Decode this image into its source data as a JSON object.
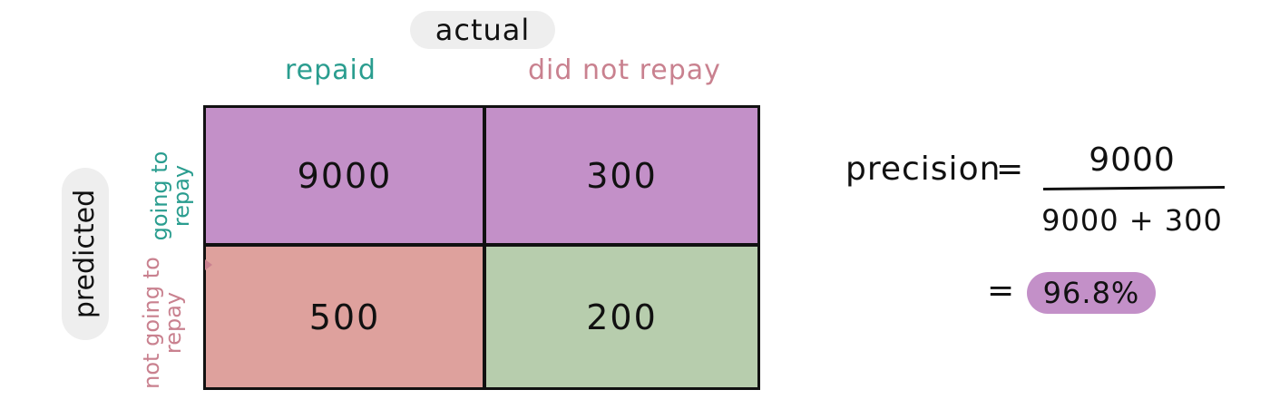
{
  "header": {
    "actual_label": "actual",
    "columns": [
      "repaid",
      "did not repay"
    ]
  },
  "side": {
    "predicted_label": "predicted",
    "rows": [
      "going to repay",
      "not going to repay"
    ]
  },
  "matrix": {
    "cells": [
      "9000",
      "300",
      "500",
      "200"
    ]
  },
  "formula": {
    "lhs": "precision",
    "equals": "=",
    "numerator": "9000",
    "denominator": "9000 + 300",
    "result": "96.8%"
  },
  "colors": {
    "teal": "#2a9d8f",
    "rose": "#c9818f",
    "purple": "#c390c8",
    "salmon": "#dea19d",
    "green": "#b7cdad"
  }
}
